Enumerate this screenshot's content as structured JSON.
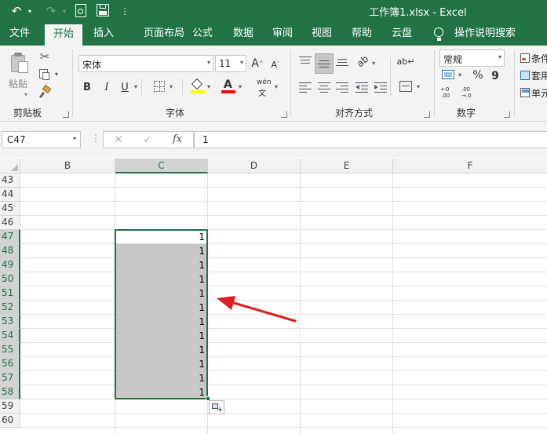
{
  "title_bar": {
    "title": "工作簿1.xlsx  -  Excel",
    "quick_access": {
      "undo": "↶",
      "redo": "↷",
      "print_preview": "🗋",
      "save": "💾",
      "customize": "≡"
    }
  },
  "tabs": [
    "文件",
    "开始",
    "插入",
    "页面布局",
    "公式",
    "数据",
    "审阅",
    "视图",
    "帮助",
    "云盘",
    "操作说明搜索"
  ],
  "ribbon": {
    "clipboard": {
      "paste_label": "粘贴",
      "group_label": "剪贴板"
    },
    "font": {
      "font_name": "宋体",
      "font_size": "11",
      "grow_label": "A",
      "shrink_label": "A",
      "bold": "B",
      "italic": "I",
      "underline": "U",
      "phonetic": "wén",
      "group_label": "字体",
      "fill_color": "#ffff00",
      "font_color": "#ff0000"
    },
    "alignment": {
      "group_label": "对齐方式"
    },
    "number": {
      "format": "常规",
      "percent": "%",
      "comma": "9",
      "group_label": "数字"
    },
    "styles": {
      "item1": "条件",
      "item2": "套用",
      "item3": "单元"
    }
  },
  "formula_bar": {
    "name_box": "C47",
    "cancel": "✕",
    "enter": "✓",
    "fx": "fx",
    "value": "1"
  },
  "sheet": {
    "columns": [
      "B",
      "C",
      "D",
      "E",
      "F"
    ],
    "selected_column": "C",
    "rows": [
      "43",
      "44",
      "45",
      "46",
      "47",
      "48",
      "49",
      "50",
      "51",
      "52",
      "53",
      "54",
      "55",
      "56",
      "57",
      "58",
      "59",
      "60"
    ],
    "selected_rows": [
      "47",
      "48",
      "49",
      "50",
      "51",
      "52",
      "53",
      "54",
      "55",
      "56",
      "57",
      "58"
    ],
    "c_values": [
      "1",
      "1",
      "1",
      "1",
      "1",
      "1",
      "1",
      "1",
      "1",
      "1",
      "1",
      "1"
    ],
    "arrow_color": "#e02020"
  }
}
